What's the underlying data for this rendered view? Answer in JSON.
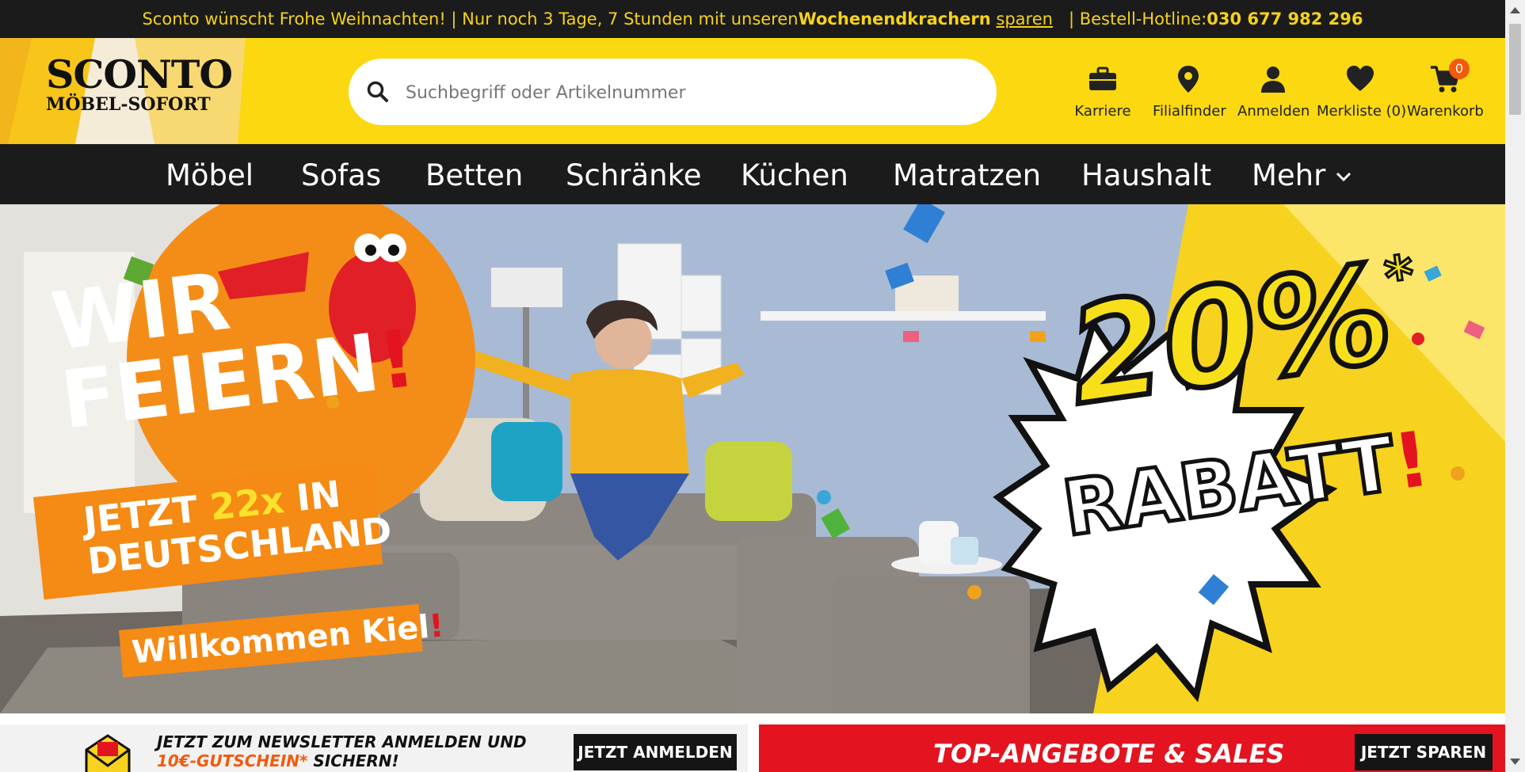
{
  "topbar": {
    "part1": "Sconto wünscht Frohe Weihnachten! | Nur noch 3 Tage, 7 Stunden mit unseren ",
    "bold1": "Wochenendkrachern",
    "link": "sparen",
    "part2": "| Bestell-Hotline: ",
    "hotline": "030 677 982 296"
  },
  "logo": {
    "line1": "SCONTO",
    "line2": "MÖBEL-SOFORT"
  },
  "search": {
    "placeholder": "Suchbegriff oder Artikelnummer",
    "value": ""
  },
  "header_icons": [
    {
      "label": "Karriere",
      "icon": "briefcase-icon"
    },
    {
      "label": "Filialfinder",
      "icon": "location-pin-icon"
    },
    {
      "label": "Anmelden",
      "icon": "user-icon"
    },
    {
      "label": "Merkliste (0)",
      "icon": "heart-icon"
    },
    {
      "label": "Warenkorb",
      "icon": "cart-icon",
      "badge": "0"
    }
  ],
  "nav": {
    "items": [
      "Möbel",
      "Sofas",
      "Betten",
      "Schränke",
      "Küchen",
      "Matratzen",
      "Haushalt",
      "Mehr"
    ]
  },
  "hero": {
    "headline1": "WIR",
    "headline2": "FEIERN",
    "exclaim": "!",
    "sub1": "JETZT ",
    "sub1_highlight": "22x",
    "sub1b": " IN",
    "sub2": "DEUTSCHLAND",
    "welcome": "Willkommen Kiel",
    "discount": "20%",
    "star": "*",
    "rabatt": "RABATT",
    "rabatt_exclaim": "!"
  },
  "promo_left": {
    "line1": "JETZT ZUM NEWSLETTER ANMELDEN UND",
    "line2_highlight": "10€-GUTSCHEIN*",
    "line2_rest": " SICHERN!",
    "button": "JETZT ANMELDEN"
  },
  "promo_right": {
    "title": "TOP-ANGEBOTE & SALES",
    "button": "JETZT SPAREN"
  },
  "colors": {
    "brand_yellow": "#fbd80f",
    "dark": "#1b1b1b",
    "orange": "#f58a14",
    "red": "#e3141f"
  }
}
